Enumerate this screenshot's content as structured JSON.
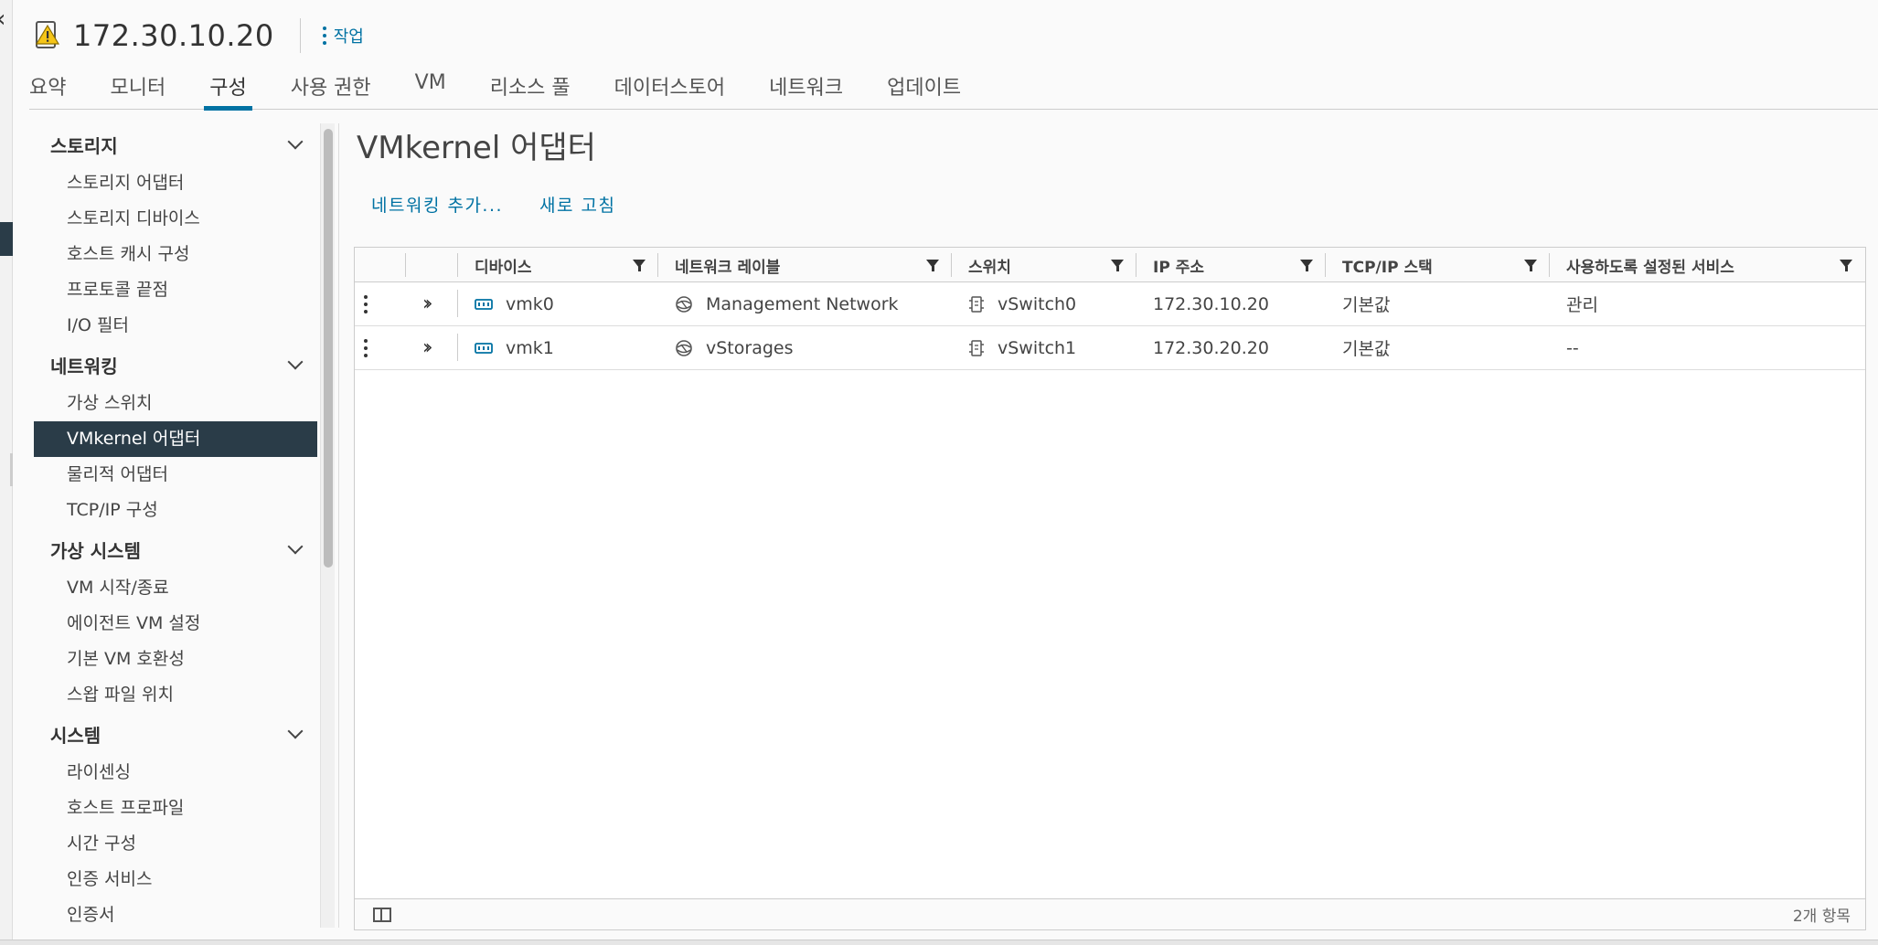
{
  "header": {
    "host_name": "172.30.10.20",
    "host_icon": "host-warning-icon",
    "actions_label": "작업"
  },
  "tabs": [
    {
      "label": "요약"
    },
    {
      "label": "모니터"
    },
    {
      "label": "구성",
      "active": true
    },
    {
      "label": "사용 권한"
    },
    {
      "label": "VM"
    },
    {
      "label": "리소스 풀"
    },
    {
      "label": "데이터스토어"
    },
    {
      "label": "네트워크"
    },
    {
      "label": "업데이트"
    }
  ],
  "sidebar": {
    "groups": [
      {
        "title": "스토리지",
        "items": [
          "스토리지 어댑터",
          "스토리지 디바이스",
          "호스트 캐시 구성",
          "프로토콜 끝점",
          "I/O 필터"
        ]
      },
      {
        "title": "네트워킹",
        "items": [
          "가상 스위치",
          "VMkernel 어댑터",
          "물리적 어댑터",
          "TCP/IP 구성"
        ]
      },
      {
        "title": "가상 시스템",
        "items": [
          "VM 시작/종료",
          "에이전트 VM 설정",
          "기본 VM 호환성",
          "스왑 파일 위치"
        ]
      },
      {
        "title": "시스템",
        "items": [
          "라이센싱",
          "호스트 프로파일",
          "시간 구성",
          "인증 서비스",
          "인증서"
        ]
      }
    ],
    "active_item": "VMkernel 어댑터"
  },
  "main": {
    "title": "VMkernel 어댑터",
    "toolbar": {
      "add_networking": "네트워킹 추가...",
      "refresh": "새로 고침"
    },
    "grid": {
      "columns": [
        "디바이스",
        "네트워크 레이블",
        "스위치",
        "IP 주소",
        "TCP/IP 스택",
        "사용하도록 설정된 서비스"
      ],
      "rows": [
        {
          "device": "vmk0",
          "network_label": "Management Network",
          "switch": "vSwitch0",
          "ip": "172.30.10.20",
          "tcpip_stack": "기본값",
          "services": "관리"
        },
        {
          "device": "vmk1",
          "network_label": "vStorages",
          "switch": "vSwitch1",
          "ip": "172.30.20.20",
          "tcpip_stack": "기본값",
          "services": "--"
        }
      ],
      "footer_count": "2개 항목"
    }
  },
  "colors": {
    "accent": "#0072a3",
    "nav_active_bg": "#2a3c48",
    "warning": "#f5c518"
  }
}
